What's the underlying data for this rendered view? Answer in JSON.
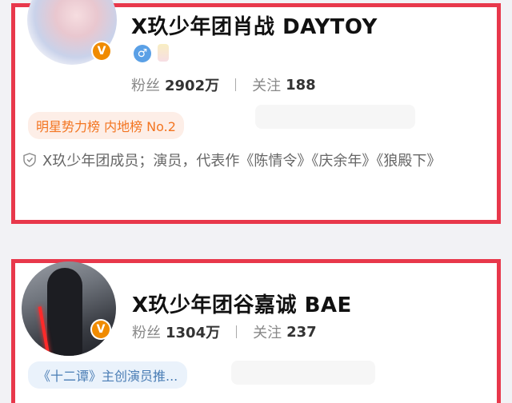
{
  "cards": [
    {
      "name": "X玖少年团肖战 DAYTOY",
      "gender_symbol": "♂",
      "followers_label": "粉丝",
      "followers_value": "2902万",
      "following_label": "关注",
      "following_value": "188",
      "rank_badge": "明星势力榜 内地榜 No.2",
      "bio": "X玖少年团成员；演员，代表作《陈情令》《庆余年》《狼殿下》",
      "verified_mark": "V"
    },
    {
      "name": "X玖少年团谷嘉诚 BAE",
      "followers_label": "粉丝",
      "followers_value": "1304万",
      "following_label": "关注",
      "following_value": "237",
      "tag": "《十二谭》主创演员推...",
      "verified_mark": "V"
    }
  ],
  "colors": {
    "highlight_border": "#e8384b",
    "verified_badge": "#f08b00",
    "rank_text": "#f37521",
    "tag_text": "#4a7db5",
    "gender_male": "#5aa0e6"
  }
}
